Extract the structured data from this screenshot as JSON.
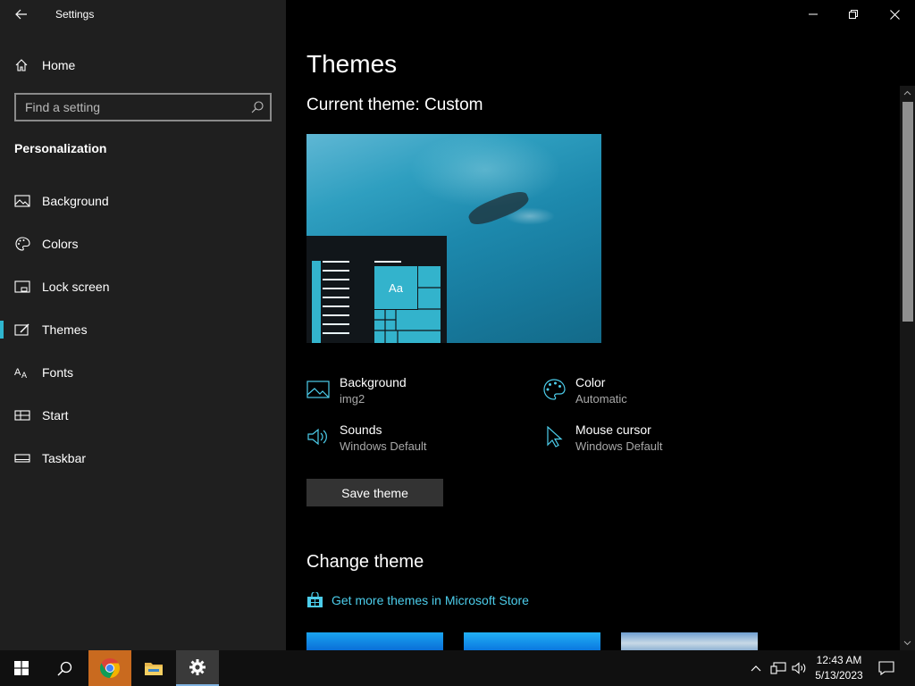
{
  "window": {
    "title": "Settings"
  },
  "sidebar": {
    "home_label": "Home",
    "search_placeholder": "Find a setting",
    "section_title": "Personalization",
    "items": [
      {
        "label": "Background",
        "icon": "image-icon"
      },
      {
        "label": "Colors",
        "icon": "palette-icon"
      },
      {
        "label": "Lock screen",
        "icon": "lock-screen-icon"
      },
      {
        "label": "Themes",
        "icon": "themes-brush-icon",
        "active": true
      },
      {
        "label": "Fonts",
        "icon": "font-icon"
      },
      {
        "label": "Start",
        "icon": "start-icon"
      },
      {
        "label": "Taskbar",
        "icon": "taskbar-icon"
      }
    ]
  },
  "main": {
    "title": "Themes",
    "current_theme": "Current theme: Custom",
    "preview_tile_text": "Aa",
    "properties": [
      {
        "title": "Background",
        "value": "img2",
        "icon": "image-icon"
      },
      {
        "title": "Color",
        "value": "Automatic",
        "icon": "palette-icon"
      },
      {
        "title": "Sounds",
        "value": "Windows Default",
        "icon": "speaker-icon"
      },
      {
        "title": "Mouse cursor",
        "value": "Windows Default",
        "icon": "cursor-icon"
      }
    ],
    "save_button": "Save theme",
    "change_theme_title": "Change theme",
    "store_link": "Get more themes in Microsoft Store"
  },
  "taskbar": {
    "time": "12:43 AM",
    "date": "5/13/2023"
  },
  "colors": {
    "accent": "#2fb6cf",
    "link": "#4ccdeb",
    "sidebar_bg": "#1f1f1f",
    "content_bg": "#000000"
  }
}
